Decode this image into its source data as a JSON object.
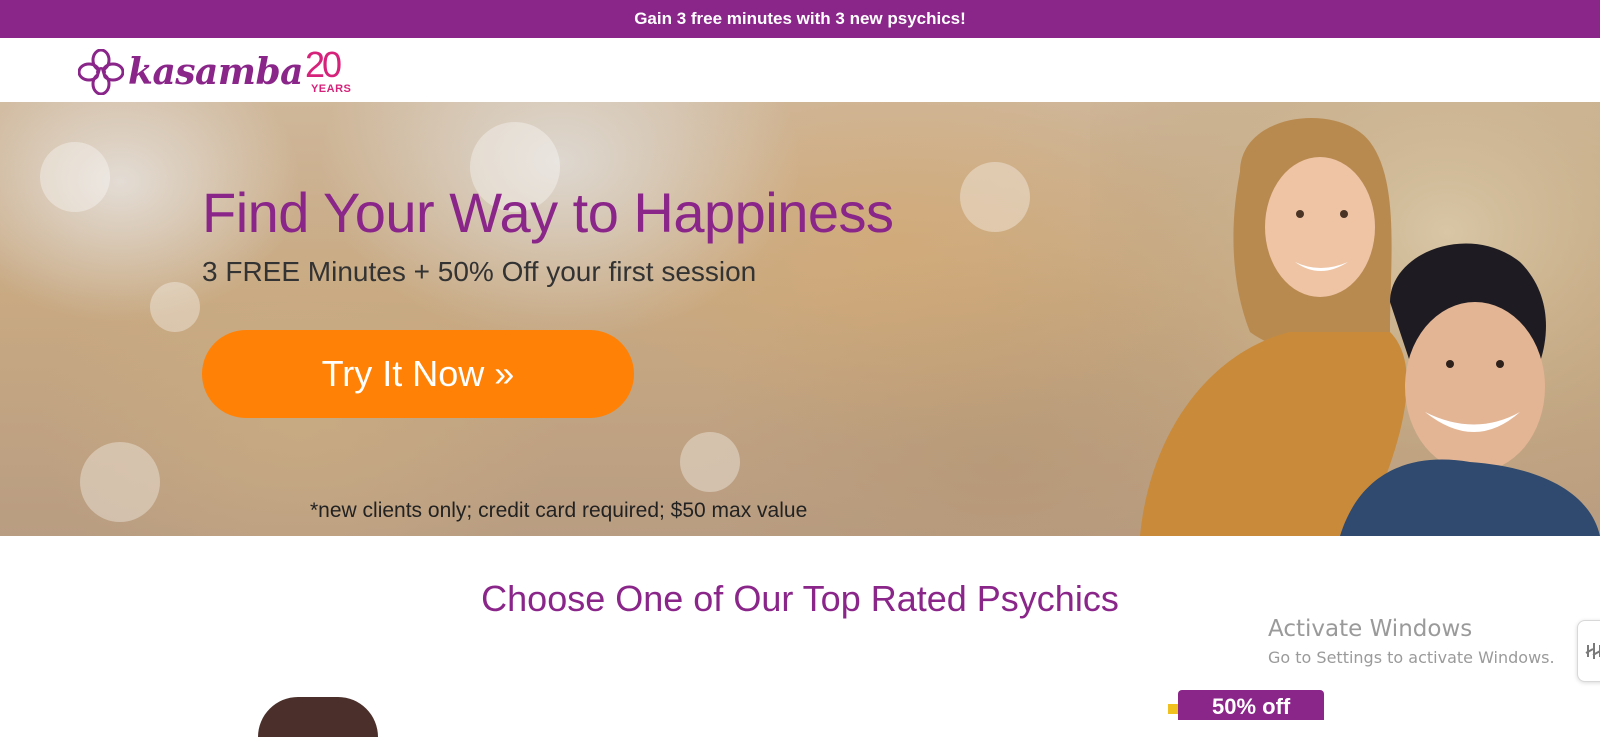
{
  "promo_bar": {
    "text": "Gain 3 free minutes with 3 new psychics!"
  },
  "logo": {
    "wordmark": "kasamba",
    "anniversary_number": "20",
    "anniversary_label": "YEARS"
  },
  "hero": {
    "title": "Find Your Way to Happiness",
    "subtitle": "3 FREE Minutes + 50% Off your first session",
    "cta_label": "Try It Now »",
    "disclaimer": "*new clients only; credit card required; $50 max value"
  },
  "section": {
    "title": "Choose One of Our Top Rated Psychics"
  },
  "discount_tag": {
    "label": "50% off"
  },
  "os_watermark": {
    "title": "Activate Windows",
    "subtitle": "Go to Settings to activate Windows."
  },
  "colors": {
    "brand_purple": "#8a258a",
    "accent_pink": "#d6227a",
    "cta_orange": "#ff8105"
  },
  "icons": [
    "flower-logo-icon",
    "chat-widget-icon"
  ]
}
